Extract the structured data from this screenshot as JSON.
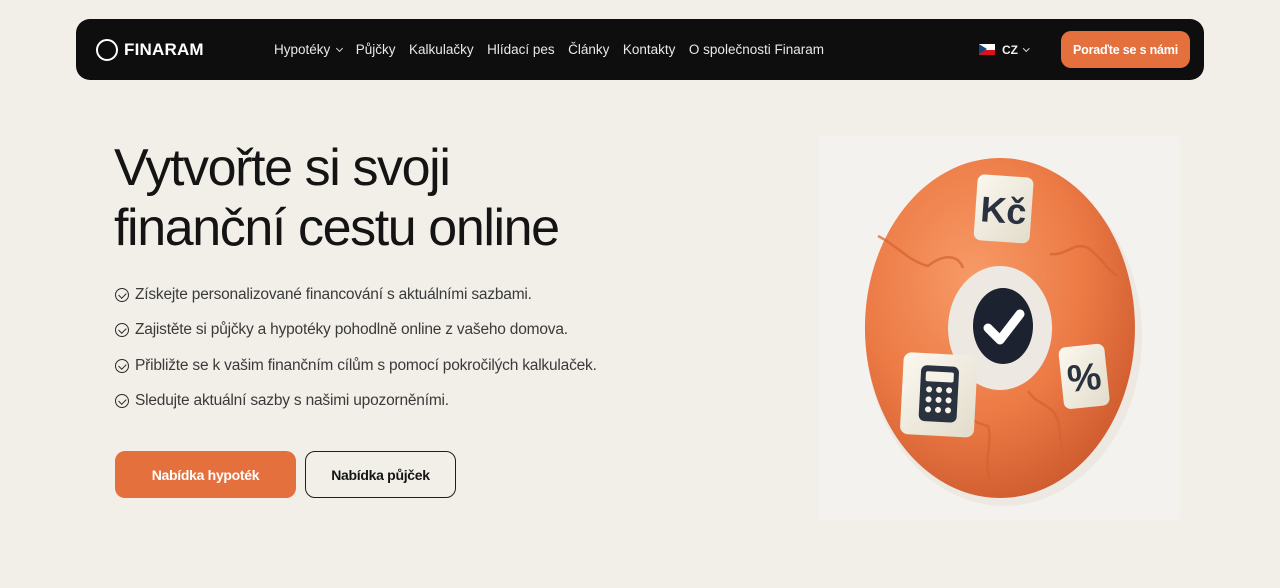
{
  "logo": {
    "text": "FINARAM"
  },
  "nav": {
    "items": [
      {
        "label": "Hypotéky",
        "dropdown": true
      },
      {
        "label": "Půjčky"
      },
      {
        "label": "Kalkulačky"
      },
      {
        "label": "Hlídací pes"
      },
      {
        "label": "Články"
      },
      {
        "label": "Kontakty"
      },
      {
        "label": "O společnosti Finaram"
      }
    ],
    "language": "CZ",
    "cta_label": "Poraďte se s námi"
  },
  "hero": {
    "title_line1": "Vytvořte si svoji",
    "title_line2": "finanční cestu online",
    "features": [
      "Získejte personalizované financování s aktuálními sazbami.",
      "Zajistěte si půjčky a hypotéky pohodlně online z vašeho domova.",
      "Přibližte se k vašim finančním cílům s pomocí pokročilých kalkulaček.",
      "Sledujte aktuální sazby s našimi upozorněními."
    ],
    "primary_button": "Nabídka hypoték",
    "secondary_button": "Nabídka půjček",
    "image": {
      "tile_currency": "Kč",
      "tile_percent": "%"
    }
  },
  "colors": {
    "accent": "#e4703d",
    "navbar": "#0e0e0e",
    "background": "#f2efe9",
    "puzzle": "#ec7a45"
  },
  "icons": [
    "logo-ring-icon",
    "chevron-down-icon",
    "czech-flag-icon",
    "check-circle-icon",
    "calculator-icon",
    "checkmark-icon"
  ]
}
